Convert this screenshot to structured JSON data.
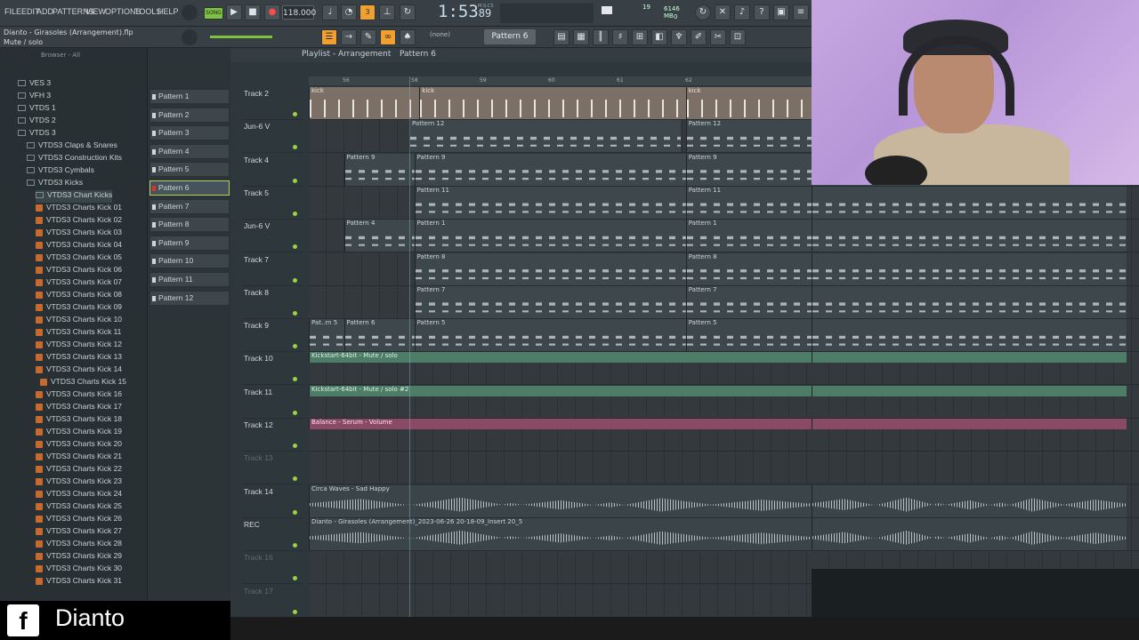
{
  "menu": [
    "FILE",
    "EDIT",
    "ADD",
    "PATTERNS",
    "VIEW",
    "OPTIONS",
    "TOOLS",
    "HELP"
  ],
  "transport": {
    "song_label": "SONG",
    "tempo": "118.000",
    "time": "1:53",
    "time_frac": "89",
    "time_unit": "M:S:CS",
    "cpu_value": "19",
    "mem": "6146 MB",
    "voices": "0"
  },
  "header": {
    "song_title": "Dianto - Girasoles (Arrangement).flp",
    "hint": "Mute / solo",
    "pattern_none": "(none)",
    "pattern_selected": "Pattern 6"
  },
  "browser": {
    "title": "Browser - All",
    "items": [
      {
        "label": "VES 3",
        "type": "folder",
        "indent": 1
      },
      {
        "label": "VFH 3",
        "type": "folder",
        "indent": 1
      },
      {
        "label": "VTDS 1",
        "type": "folder",
        "indent": 1
      },
      {
        "label": "VTDS 2",
        "type": "folder",
        "indent": 1
      },
      {
        "label": "VTDS 3",
        "type": "folder",
        "indent": 1
      },
      {
        "label": "VTDS3 Claps & Snares",
        "type": "folder",
        "indent": 2
      },
      {
        "label": "VTDS3 Construction Kits",
        "type": "folder",
        "indent": 2
      },
      {
        "label": "VTDS3 Cymbals",
        "type": "folder",
        "indent": 2
      },
      {
        "label": "VTDS3 Kicks",
        "type": "folder",
        "indent": 2
      },
      {
        "label": "VTDS3 Chart Kicks",
        "type": "folder",
        "indent": 3
      },
      {
        "label": "VTDS3 Charts Kick 01",
        "type": "file",
        "indent": 3
      },
      {
        "label": "VTDS3 Charts Kick 02",
        "type": "file",
        "indent": 3
      },
      {
        "label": "VTDS3 Charts Kick 03",
        "type": "file",
        "indent": 3
      },
      {
        "label": "VTDS3 Charts Kick 04",
        "type": "file",
        "indent": 3
      },
      {
        "label": "VTDS3 Charts Kick 05",
        "type": "file",
        "indent": 3
      },
      {
        "label": "VTDS3 Charts Kick 06",
        "type": "file",
        "indent": 3
      },
      {
        "label": "VTDS3 Charts Kick 07",
        "type": "file",
        "indent": 3
      },
      {
        "label": "VTDS3 Charts Kick 08",
        "type": "file",
        "indent": 3
      },
      {
        "label": "VTDS3 Charts Kick 09",
        "type": "file",
        "indent": 3
      },
      {
        "label": "VTDS3 Charts Kick 10",
        "type": "file",
        "indent": 3
      },
      {
        "label": "VTDS3 Charts Kick 11",
        "type": "file",
        "indent": 3
      },
      {
        "label": "VTDS3 Charts Kick 12",
        "type": "file",
        "indent": 3
      },
      {
        "label": "VTDS3 Charts Kick 13",
        "type": "file",
        "indent": 3
      },
      {
        "label": "VTDS3 Charts Kick 14",
        "type": "file",
        "indent": 3
      },
      {
        "label": "VTDS3 Charts Kick 15",
        "type": "file",
        "indent": 3.5
      },
      {
        "label": "VTDS3 Charts Kick 16",
        "type": "file",
        "indent": 3
      },
      {
        "label": "VTDS3 Charts Kick 17",
        "type": "file",
        "indent": 3
      },
      {
        "label": "VTDS3 Charts Kick 18",
        "type": "file",
        "indent": 3
      },
      {
        "label": "VTDS3 Charts Kick 19",
        "type": "file",
        "indent": 3
      },
      {
        "label": "VTDS3 Charts Kick 20",
        "type": "file",
        "indent": 3
      },
      {
        "label": "VTDS3 Charts Kick 21",
        "type": "file",
        "indent": 3
      },
      {
        "label": "VTDS3 Charts Kick 22",
        "type": "file",
        "indent": 3
      },
      {
        "label": "VTDS3 Charts Kick 23",
        "type": "file",
        "indent": 3
      },
      {
        "label": "VTDS3 Charts Kick 24",
        "type": "file",
        "indent": 3
      },
      {
        "label": "VTDS3 Charts Kick 25",
        "type": "file",
        "indent": 3
      },
      {
        "label": "VTDS3 Charts Kick 26",
        "type": "file",
        "indent": 3
      },
      {
        "label": "VTDS3 Charts Kick 27",
        "type": "file",
        "indent": 3
      },
      {
        "label": "VTDS3 Charts Kick 28",
        "type": "file",
        "indent": 3
      },
      {
        "label": "VTDS3 Charts Kick 29",
        "type": "file",
        "indent": 3
      },
      {
        "label": "VTDS3 Charts Kick 30",
        "type": "file",
        "indent": 3
      },
      {
        "label": "VTDS3 Charts Kick 31",
        "type": "file",
        "indent": 3
      }
    ]
  },
  "patterns": [
    "Pattern 1",
    "Pattern 2",
    "Pattern 3",
    "Pattern 4",
    "Pattern 5",
    "Pattern 6",
    "Pattern 7",
    "Pattern 8",
    "Pattern 9",
    "Pattern 10",
    "Pattern 11",
    "Pattern 12"
  ],
  "pattern_selected_index": 5,
  "playlist": {
    "title": "Playlist - Arrangement",
    "breadcrumb": "Pattern 6",
    "ruler": [
      "56",
      "58",
      "59",
      "60",
      "61",
      "62"
    ],
    "tracks": [
      {
        "name": "Track 2",
        "dim": false,
        "clips": [
          {
            "label": "kick",
            "kind": "kick",
            "start": 0,
            "len": 1
          },
          {
            "label": "kick",
            "kind": "kick",
            "start": 0.22,
            "len": 1
          },
          {
            "label": "kick",
            "kind": "kick",
            "start": 0.75,
            "len": 1
          }
        ]
      },
      {
        "name": "Jun-6 V",
        "dim": false,
        "clips": [
          {
            "label": "Pattern 12",
            "kind": "notes",
            "start": 0.2,
            "len": 0.54
          },
          {
            "label": "Pattern 12",
            "kind": "notes",
            "start": 0.75,
            "len": 0.25
          }
        ]
      },
      {
        "name": "Track 4",
        "dim": false,
        "clips": [
          {
            "label": "Pattern 9",
            "kind": "notes",
            "start": 0.07,
            "len": 0.14
          },
          {
            "label": "Pattern 9",
            "kind": "notes",
            "start": 0.21,
            "len": 0.54
          },
          {
            "label": "Pattern 9",
            "kind": "notes",
            "start": 0.75,
            "len": 0.25
          }
        ]
      },
      {
        "name": "Track 5",
        "dim": false,
        "clips": [
          {
            "label": "Pattern 11",
            "kind": "notes",
            "start": 0.21,
            "len": 0.54
          },
          {
            "label": "Pattern 11",
            "kind": "notes",
            "start": 0.75,
            "len": 0.25
          }
        ]
      },
      {
        "name": "Jun-6 V",
        "dim": false,
        "clips": [
          {
            "label": "Pattern 4",
            "kind": "notes",
            "start": 0.07,
            "len": 0.14
          },
          {
            "label": "Pattern 1",
            "kind": "notes",
            "start": 0.21,
            "len": 0.54
          },
          {
            "label": "Pattern 1",
            "kind": "notes",
            "start": 0.75,
            "len": 0.25
          }
        ]
      },
      {
        "name": "Track 7",
        "dim": false,
        "clips": [
          {
            "label": "Pattern 8",
            "kind": "notes",
            "start": 0.21,
            "len": 0.54
          },
          {
            "label": "Pattern 8",
            "kind": "notes",
            "start": 0.75,
            "len": 0.25
          }
        ]
      },
      {
        "name": "Track 8",
        "dim": false,
        "clips": [
          {
            "label": "Pattern 7",
            "kind": "notes",
            "start": 0.21,
            "len": 0.54
          },
          {
            "label": "Pattern 7",
            "kind": "notes",
            "start": 0.75,
            "len": 0.25
          }
        ]
      },
      {
        "name": "Track 9",
        "dim": false,
        "clips": [
          {
            "label": "Pat..rn 5",
            "kind": "notes",
            "start": 0,
            "len": 0.07
          },
          {
            "label": "Pattern 6",
            "kind": "notes",
            "start": 0.07,
            "len": 0.14
          },
          {
            "label": "Pattern 5",
            "kind": "notes",
            "start": 0.21,
            "len": 0.54
          },
          {
            "label": "Pattern 5",
            "kind": "notes",
            "start": 0.75,
            "len": 0.25
          }
        ]
      },
      {
        "name": "Track 10",
        "dim": false,
        "clips": [
          {
            "label": "Kickstart-64bit - Mute / solo",
            "kind": "green",
            "start": 0,
            "len": 1
          }
        ]
      },
      {
        "name": "Track 11",
        "dim": false,
        "clips": [
          {
            "label": "Kickstart-64bit - Mute / solo #2",
            "kind": "green",
            "start": 0,
            "len": 1
          }
        ]
      },
      {
        "name": "Track 12",
        "dim": false,
        "clips": [
          {
            "label": "Balance - Serum - Volume",
            "kind": "pink",
            "start": 0,
            "len": 1
          }
        ]
      },
      {
        "name": "Track 13",
        "dim": true,
        "clips": []
      },
      {
        "name": "Track 14",
        "dim": false,
        "clips": [
          {
            "label": "Circa Waves - Sad Happy",
            "kind": "audio",
            "start": 0,
            "len": 1
          }
        ]
      },
      {
        "name": "REC",
        "dim": false,
        "clips": [
          {
            "label": "Dianto - Girasoles (Arrangement)_2023-06-26 20-18-09_Insert 20_5",
            "kind": "audio",
            "start": 0,
            "len": 1
          }
        ]
      },
      {
        "name": "Track 16",
        "dim": true,
        "clips": []
      },
      {
        "name": "Track 17",
        "dim": true,
        "clips": []
      }
    ]
  },
  "overlay": {
    "name": "Dianto",
    "icon": "facebook-icon",
    "icon_glyph": "f"
  }
}
